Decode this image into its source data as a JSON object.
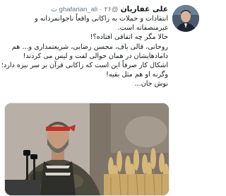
{
  "tweet": {
    "author_name": "علی غفاریان",
    "author_handle": "@ghafarian_ali",
    "separator": "·",
    "time": "۲۶ ت",
    "lines": [
      "انتقادات و حملات به زاکانی واقعاً ناجوانمردانه و",
      "غیرمنصفانه است.",
      "حالا مگر چه اتفاقی افتاده؟!",
      "روحانی، قالی باف، محسن رضایی، شریعتمداری و... هم",
      "دامادهایشان در همان حوالی لفت و لیس می کردند!",
      "اشکال کار صرفاً این است که زاکانی قرآن بر سر نیزه دارد؛",
      "وگرنه او هم مثل بقیه!",
      "نوش جان..."
    ]
  },
  "icons": {
    "avatar": "profile-photo",
    "media": "photo-man-with-red-headband-and-wheat"
  },
  "colors": {
    "text": "#14171a",
    "muted": "#657786",
    "headband": "#c0302a"
  }
}
